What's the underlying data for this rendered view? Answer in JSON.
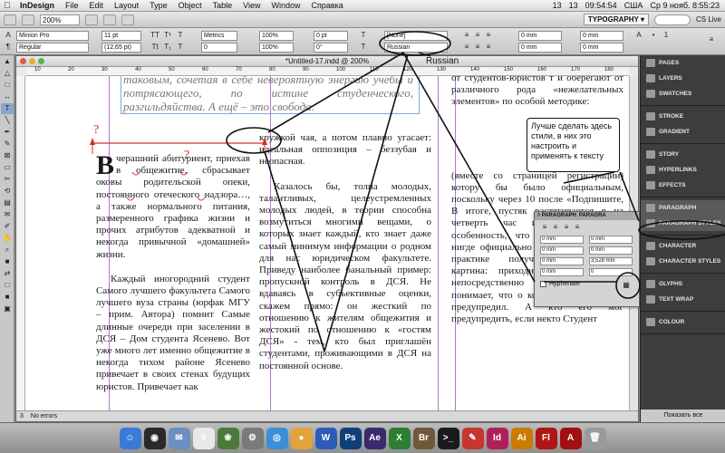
{
  "menubar": {
    "app": "InDesign",
    "items": [
      "File",
      "Edit",
      "Layout",
      "Type",
      "Object",
      "Table",
      "View",
      "Window",
      "Справка"
    ],
    "status": [
      "13",
      "13",
      "09:54:54",
      "США",
      "Ср 9 нояб. 8:55:23"
    ]
  },
  "appbar": {
    "zoom": "200%",
    "workspace": "TYPOGRAPHY ▾",
    "cslive": "CS Live"
  },
  "control": {
    "font": "Minion Pro",
    "style": "Regular",
    "size": "11 pt",
    "leading": "(12,65 pt)",
    "kerning": "Metrics",
    "tracking": "0",
    "scale_v": "100%",
    "scale_h": "100%",
    "baseline": "0 pt",
    "skew": "0°",
    "char_style": "[None]",
    "language": "Russian",
    "indent_left": "0 mm",
    "indent_first": "0 mm",
    "indent_right": "0 mm",
    "space_after": "0 mm"
  },
  "document": {
    "title": "*Untitled-17.indd @ 200%",
    "status": "No errors",
    "page_num": "3",
    "ruler": [
      "10",
      "20",
      "30",
      "40",
      "50",
      "60",
      "70",
      "80",
      "90",
      "100",
      "110",
      "120",
      "130",
      "140",
      "150",
      "160",
      "170",
      "180"
    ],
    "col1_top_italic": "таковым, сочетая в себе невероятную энергию учебы и потрясающего, по истине студенческого, разгильдяйства. А ещё – это свобода.",
    "col1_dropcap": "В",
    "col1_p1": "черашний        абитуриент, приехав в общежитие, сбрасывает оковы      родительской      опеки, постоянного отеческого надзора…, а также нормального питания, размеренного графика жизни и прочих атрибутов адекватной и некогда привычной «домашней» жизни.",
    "col1_p2": "Каждый иногородний студент Самого лучшего факультета Самого лучшего вуза страны (юрфак МГУ – прим. Автора) помнит Самые длинные очереди при заселении в ДСЯ – Дом студента Ясенево. Вот уже много лет именно общежитие в некогда тихом районе Ясенево привечает в своих стенах будущих юристов. Привечает как",
    "col2_p1": "кружкой чая, а потом плавно угасает: идеальная оппозиция – беззубая и неопасная.",
    "col2_p2": "Казалось бы, толпа молодых, талантливых, целеустремленных молодых людей, в теории способна возмутиться многими вещами, о которых знает каждый, кто знает даже самый минимум информации о родном для нас юридическом факультете. Приведу наиболее банальный пример: пропускной контроль в ДСЯ. Не вдаваясь в субъективные оценки, скажем прямо: он жесткий по отношению к жителям общежития и жестокий по отношению к «гостям ДСЯ» - тем, кто был приглашён студентами, проживающими в ДСЯ на постоянной основе.",
    "col3_p1": "от студентов-юристов т и оберегают от различного рода «нежелательных элементов» по особой методике:",
    "col3_p2": "(вместе со страницей регистрации) котору    бы    было официальным,    поскольку через 10 после «Подпишите, В итоге, пустяк растягивается в на четверть час извечную русскую особенность, что подобный порядок нигде официально не прописан, то на практике получается следующая картина: приходит некто Гость и непосредственно перед вахтой понимает, что о копи паспорта его не предупредил. А кто его мог предупредить, если некто Студент"
  },
  "paragraph_panel": {
    "tabs": [
      "◊ PARAGRAPH",
      "PARAGRA"
    ],
    "fields": [
      "0 mm",
      "0 mm",
      "0 mm",
      "0 mm",
      "0 mm",
      "3,528 mm",
      "0 mm",
      "0"
    ],
    "hyphenate": "Hyphenate"
  },
  "dock": {
    "groups": [
      [
        "PAGES",
        "LAYERS",
        "SWATCHES"
      ],
      [
        "STROKE",
        "GRADIENT"
      ],
      [
        "STORY",
        "HYPERLINKS",
        "EFFECTS"
      ],
      [
        "PARAGRAPH",
        "PARAGRAPH STYLES"
      ],
      [
        "CHARACTER",
        "CHARACTER STYLES"
      ],
      [
        "GLYPHS",
        "TEXT WRAP"
      ],
      [
        "COLOUR"
      ]
    ],
    "show_all": "Показать все"
  },
  "annotations": {
    "russian": "Russian",
    "note": "Лучше сделать здесь стили, в них это настроить и применять к тексту",
    "question_marks": [
      "?",
      "?"
    ]
  },
  "colors": {
    "annotation_red": "#d92b2b",
    "dock_bg": "#3d3d3d",
    "guide": "#b577c9"
  },
  "macdock": [
    "Finder",
    "Dashboard",
    "Mail",
    "iCal",
    "Photos",
    "Preferences",
    "Safari",
    "Chrome",
    "Word",
    "Photoshop",
    "After Effects",
    "Excel",
    "Bridge",
    "Terminal",
    "PDF",
    "InDesign",
    "Illustrator",
    "Flash",
    "Acrobat",
    "Trash"
  ]
}
